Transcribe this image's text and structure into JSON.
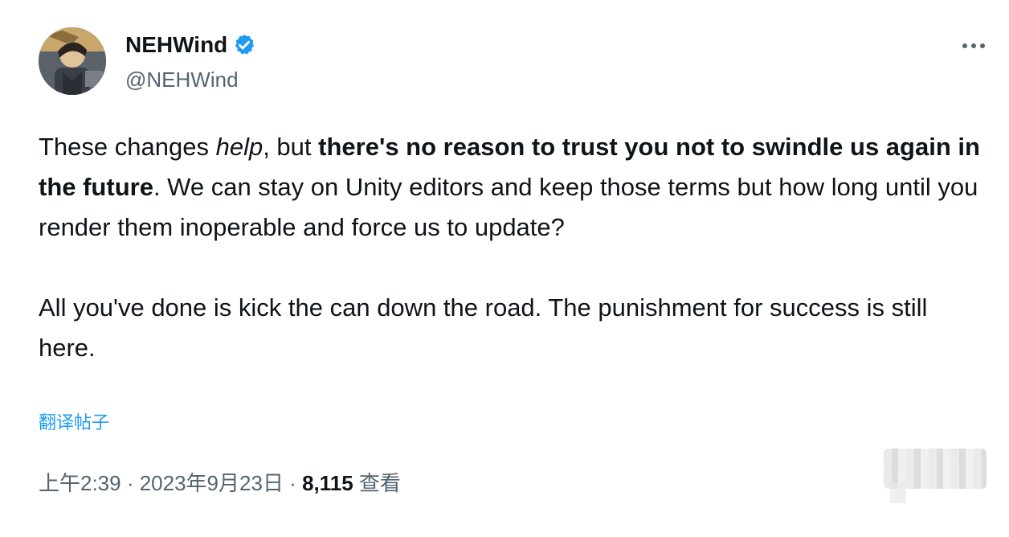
{
  "author": {
    "display_name": "NEHWind",
    "handle": "@NEHWind",
    "verified": true
  },
  "tweet": {
    "para1": {
      "t1": "These changes ",
      "t2": "help",
      "t3": ", but ",
      "t4": "there's no reason to trust you not to swindle us again in the future",
      "t5": ". We can stay on Unity editors and keep those terms but how long until you render them inoperable and force us to update?"
    },
    "para2": "All you've done is kick the can down the road. The punishment for success is still here.",
    "translate_label": "翻译帖子"
  },
  "meta": {
    "time": "上午2:39",
    "separator": " · ",
    "date": "2023年9月23日",
    "views_count": "8,115",
    "views_label": " 查看"
  },
  "colors": {
    "accent": "#1d9bf0",
    "text_primary": "#0f1419",
    "text_secondary": "#536471"
  },
  "icons": {
    "verified": "verified-badge-icon",
    "more": "more-horizontal-icon"
  }
}
